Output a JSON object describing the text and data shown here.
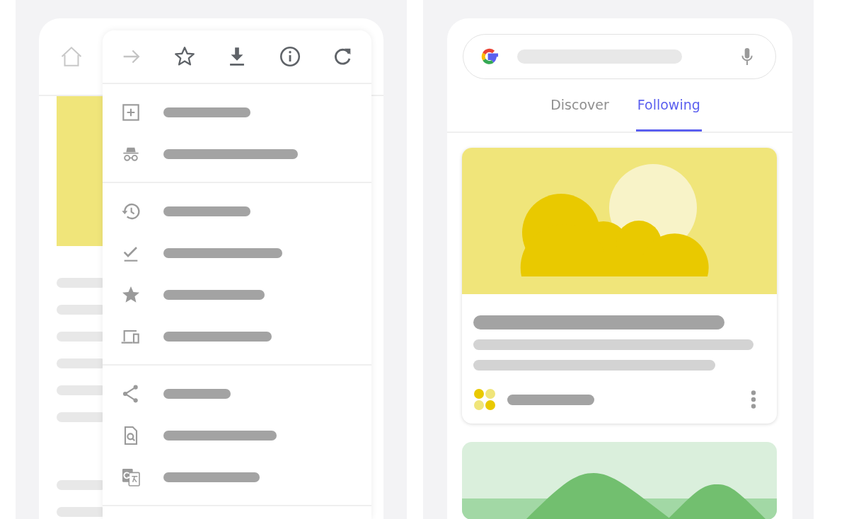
{
  "browser": {
    "home": {
      "disabled": true
    },
    "menu": {
      "toolbar": [
        {
          "kind": "forward",
          "disabled": true
        },
        {
          "kind": "bookmark",
          "disabled": false
        },
        {
          "kind": "download",
          "disabled": false
        },
        {
          "kind": "info",
          "disabled": false
        },
        {
          "kind": "reload",
          "disabled": false
        }
      ],
      "sections": [
        {
          "items": [
            {
              "kind": "new-tab"
            },
            {
              "kind": "incognito"
            }
          ]
        },
        {
          "items": [
            {
              "kind": "history"
            },
            {
              "kind": "downloads"
            },
            {
              "kind": "bookmarks"
            },
            {
              "kind": "devices"
            }
          ]
        },
        {
          "items": [
            {
              "kind": "share"
            },
            {
              "kind": "find"
            },
            {
              "kind": "translate"
            }
          ]
        }
      ]
    }
  },
  "feed": {
    "tabs": [
      {
        "label": "Discover",
        "selected": false
      },
      {
        "label": "Following",
        "selected": true
      }
    ],
    "cards": [
      {
        "kind": "sunny"
      },
      {
        "kind": "hills"
      }
    ]
  }
}
